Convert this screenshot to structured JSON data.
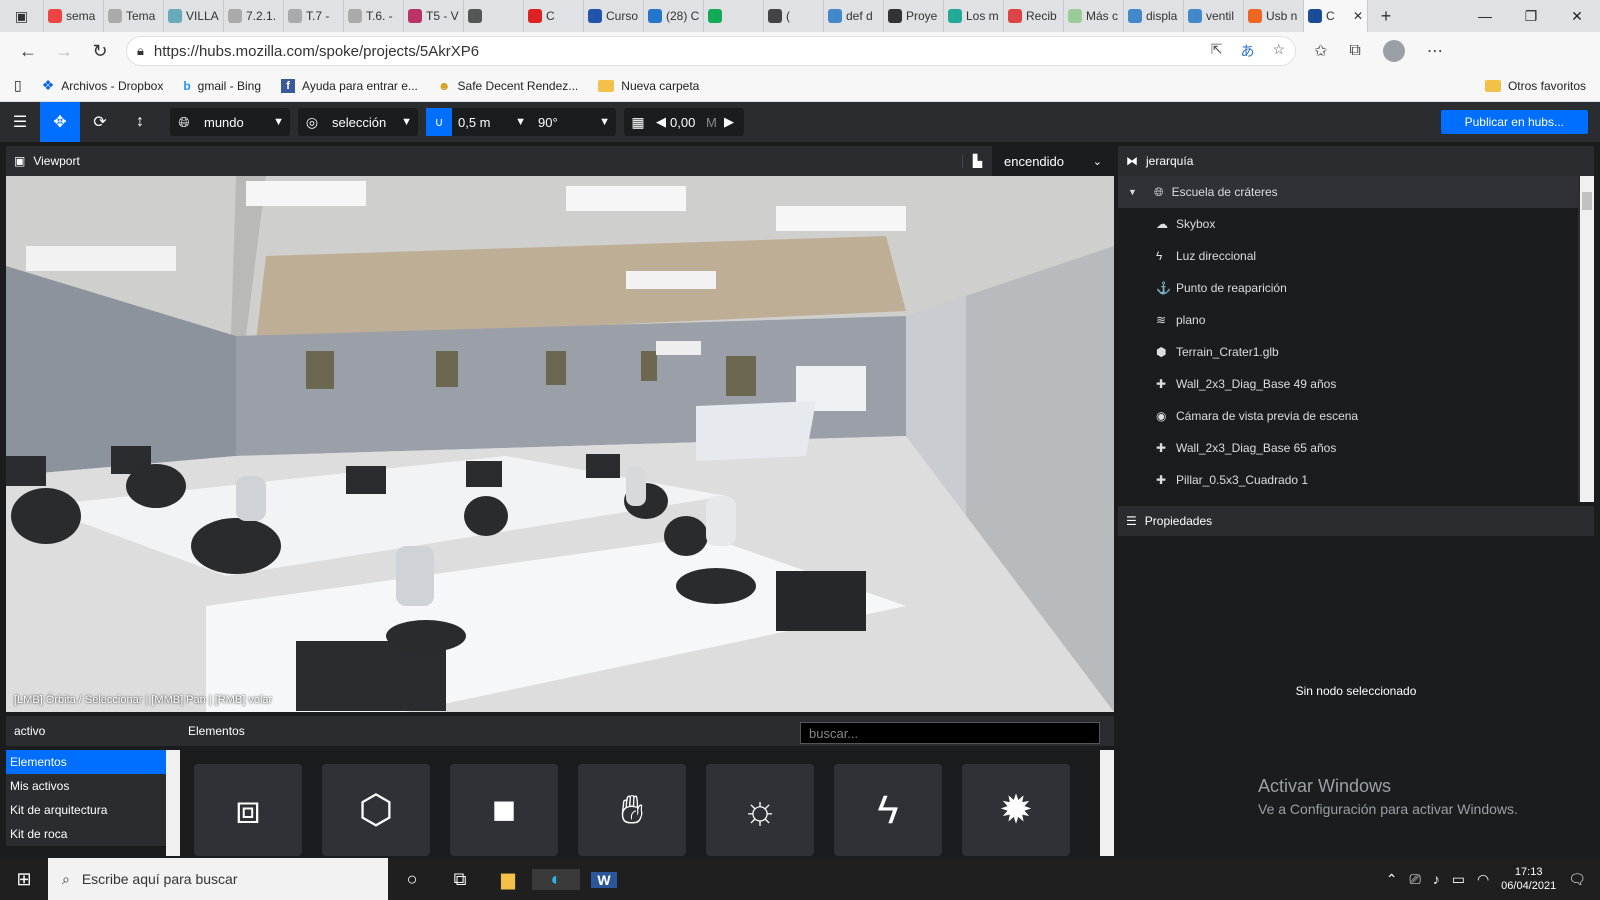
{
  "browser": {
    "tabs": [
      {
        "label": "sema",
        "color": "#e44"
      },
      {
        "label": "Tema",
        "color": "#aaa"
      },
      {
        "label": "VILLA",
        "color": "#6ab"
      },
      {
        "label": "7.2.1.",
        "color": "#aaa"
      },
      {
        "label": "T.7 -",
        "color": "#aaa"
      },
      {
        "label": "T.6. -",
        "color": "#aaa"
      },
      {
        "label": "T5 - V",
        "color": "#b36"
      },
      {
        "label": "",
        "color": "#555"
      },
      {
        "label": "C",
        "color": "#d22"
      },
      {
        "label": "Curso",
        "color": "#25a"
      },
      {
        "label": "(28) C",
        "color": "#27c"
      },
      {
        "label": "",
        "color": "#1a5"
      },
      {
        "label": "(",
        "color": "#444"
      },
      {
        "label": "def d",
        "color": "#48c"
      },
      {
        "label": "Proye",
        "color": "#333"
      },
      {
        "label": "Los m",
        "color": "#2a9"
      },
      {
        "label": "Recib",
        "color": "#d44"
      },
      {
        "label": "Más c",
        "color": "#9c9"
      },
      {
        "label": "displa",
        "color": "#48c"
      },
      {
        "label": "ventil",
        "color": "#48c"
      },
      {
        "label": "Usb n",
        "color": "#e62"
      },
      {
        "label": "C",
        "color": "#1a4c9a"
      }
    ],
    "new_tab": "+",
    "win_min": "—",
    "win_max": "❐",
    "win_close": "✕",
    "url": "https://hubs.mozilla.com/spoke/projects/5AkrXP6",
    "bookmarks": [
      {
        "label": "Archivos - Dropbox"
      },
      {
        "label": "gmail - Bing"
      },
      {
        "label": "Ayuda para entrar e..."
      },
      {
        "label": "Safe Decent Rendez..."
      },
      {
        "label": "Nueva carpeta"
      }
    ],
    "other_favorites": "Otros favoritos"
  },
  "toolbar": {
    "space": "mundo",
    "pivot": "selección",
    "snap": "0,5 m",
    "angle": "90°",
    "grid_value": "0,00",
    "grid_unit": "M",
    "publish": "Publicar en hubs..."
  },
  "viewport": {
    "title": "Viewport",
    "render_mode": "encendido",
    "help": "[LMB] Órbita / Seleccionar | [MMB] Pan | [RMB] volar"
  },
  "hierarchy": {
    "title": "jerarquía",
    "root": "Escuela de cráteres",
    "items": [
      {
        "label": "Skybox",
        "icon": "☁"
      },
      {
        "label": "Luz direccional",
        "icon": "ϟ"
      },
      {
        "label": "Punto de reaparición",
        "icon": "⚓"
      },
      {
        "label": "plano",
        "icon": "≋"
      },
      {
        "label": "Terrain_Crater1.glb",
        "icon": "⬢"
      },
      {
        "label": "Wall_2x3_Diag_Base 49 años",
        "icon": "✚"
      },
      {
        "label": "Cámara de vista previa de escena",
        "icon": "◉"
      },
      {
        "label": "Wall_2x3_Diag_Base 65 años",
        "icon": "✚"
      },
      {
        "label": "Pillar_0.5x3_Cuadrado 1",
        "icon": "✚"
      }
    ]
  },
  "properties": {
    "title": "Propiedades",
    "empty": "Sin nodo seleccionado"
  },
  "windows_activation": {
    "title": "Activar Windows",
    "subtitle": "Ve a Configuración para activar Windows."
  },
  "assets": {
    "title": "activo",
    "categories": [
      "Elementos",
      "Mis activos",
      "Kit de arquitectura",
      "Kit de roca"
    ],
    "section_title": "Elementos",
    "search_placeholder": "buscar..."
  },
  "taskbar": {
    "search_placeholder": "Escribe aquí para buscar",
    "time": "17:13",
    "date": "06/04/2021"
  }
}
